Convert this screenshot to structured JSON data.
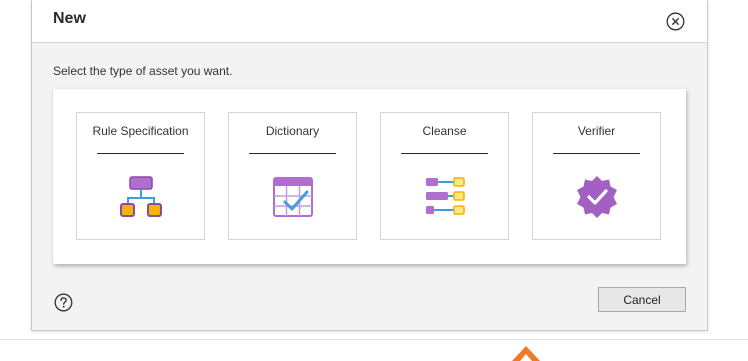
{
  "dialog": {
    "title": "New",
    "prompt": "Select the type of asset you want.",
    "close_icon": "close-circle-icon",
    "help_icon": "help-circle-icon",
    "cancel_label": "Cancel"
  },
  "asset_types": [
    {
      "label": "Rule Specification",
      "icon": "rule-specification-icon"
    },
    {
      "label": "Dictionary",
      "icon": "dictionary-icon"
    },
    {
      "label": "Cleanse",
      "icon": "cleanse-icon"
    },
    {
      "label": "Verifier",
      "icon": "verifier-icon"
    }
  ],
  "colors": {
    "icon_purple": "#a45fc3",
    "icon_orange": "#f5b400",
    "icon_blue": "#3f9ee3",
    "icon_yellow_fill": "#ffe88a",
    "backdrop_accent": "#f07a2a"
  }
}
